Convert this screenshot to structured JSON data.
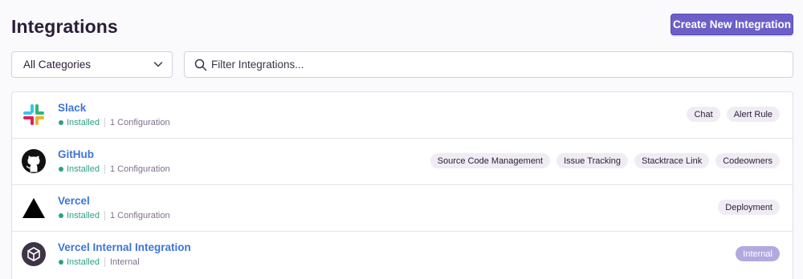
{
  "header": {
    "title": "Integrations",
    "create_button": "Create New Integration"
  },
  "filters": {
    "category_value": "All Categories",
    "search_placeholder": "Filter Integrations..."
  },
  "integrations": [
    {
      "name": "Slack",
      "status": "Installed",
      "detail": "1 Configuration",
      "tags": [
        "Chat",
        "Alert Rule"
      ]
    },
    {
      "name": "GitHub",
      "status": "Installed",
      "detail": "1 Configuration",
      "tags": [
        "Source Code Management",
        "Issue Tracking",
        "Stacktrace Link",
        "Codeowners"
      ]
    },
    {
      "name": "Vercel",
      "status": "Installed",
      "detail": "1 Configuration",
      "tags": [
        "Deployment"
      ]
    },
    {
      "name": "Vercel Internal Integration",
      "status": "Installed",
      "detail": "Internal",
      "tags": [
        "Internal"
      ]
    }
  ],
  "colors": {
    "accent": "#6c5fc7",
    "link": "#3d74db",
    "installed": "#2ba185",
    "internal_tag": "#b2a9e0"
  },
  "icons": [
    "chevron-down-icon",
    "search-icon",
    "slack-logo-icon",
    "github-logo-icon",
    "vercel-logo-icon",
    "internal-integration-icon"
  ]
}
